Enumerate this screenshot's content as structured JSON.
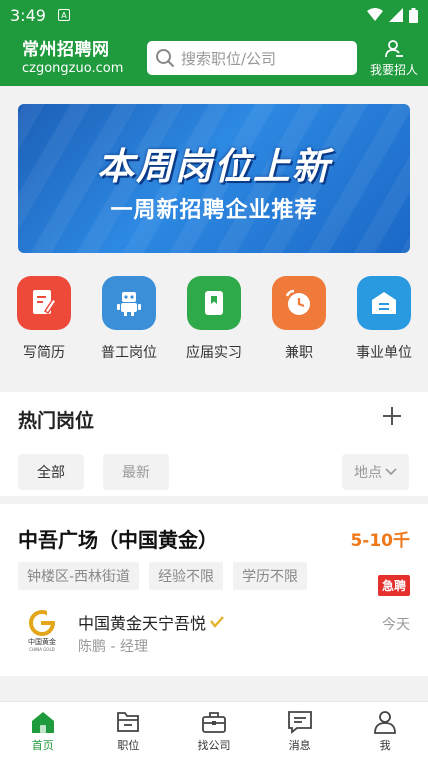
{
  "status_bar": {
    "time": "3:49"
  },
  "header": {
    "logo_cn": "常州招聘网",
    "logo_en": "czgongzuo.com",
    "search_placeholder": "搜索职位/公司",
    "recruit_label": "我要招人"
  },
  "banner": {
    "title": "本周岗位上新",
    "subtitle": "一周新招聘企业推荐"
  },
  "categories": [
    {
      "label": "写简历",
      "color": "#ee4a3a",
      "icon": "resume-icon"
    },
    {
      "label": "普工岗位",
      "color": "#3a8fd8",
      "icon": "robot-icon"
    },
    {
      "label": "应届实习",
      "color": "#2eaa4a",
      "icon": "book-icon"
    },
    {
      "label": "兼职",
      "color": "#f07a3a",
      "icon": "clock-icon"
    },
    {
      "label": "事业单位",
      "color": "#2a9ae0",
      "icon": "building-icon"
    }
  ],
  "hot_jobs": {
    "title": "热门岗位",
    "filters": [
      "全部",
      "最新"
    ],
    "location_filter": "地点"
  },
  "job": {
    "title": "中吾广场（中国黄金）",
    "salary": "5-10千",
    "tags": [
      "钟楼区-西林街道",
      "经验不限",
      "学历不限"
    ],
    "urgent": "急聘",
    "company": "中国黄金天宁吾悦",
    "contact": "陈鹏 - 经理",
    "date": "今天",
    "logo_text": "中国黄金",
    "logo_sub": "CHINA GOLD"
  },
  "tabbar": {
    "items": [
      {
        "label": "首页",
        "icon": "home-icon",
        "active": true
      },
      {
        "label": "职位",
        "icon": "folder-icon",
        "active": false
      },
      {
        "label": "找公司",
        "icon": "briefcase-icon",
        "active": false
      },
      {
        "label": "消息",
        "icon": "message-icon",
        "active": false
      },
      {
        "label": "我",
        "icon": "person-icon",
        "active": false
      }
    ]
  },
  "colors": {
    "brand": "#1f9a3c",
    "salary": "#f07818",
    "urgent": "#e5302e"
  }
}
